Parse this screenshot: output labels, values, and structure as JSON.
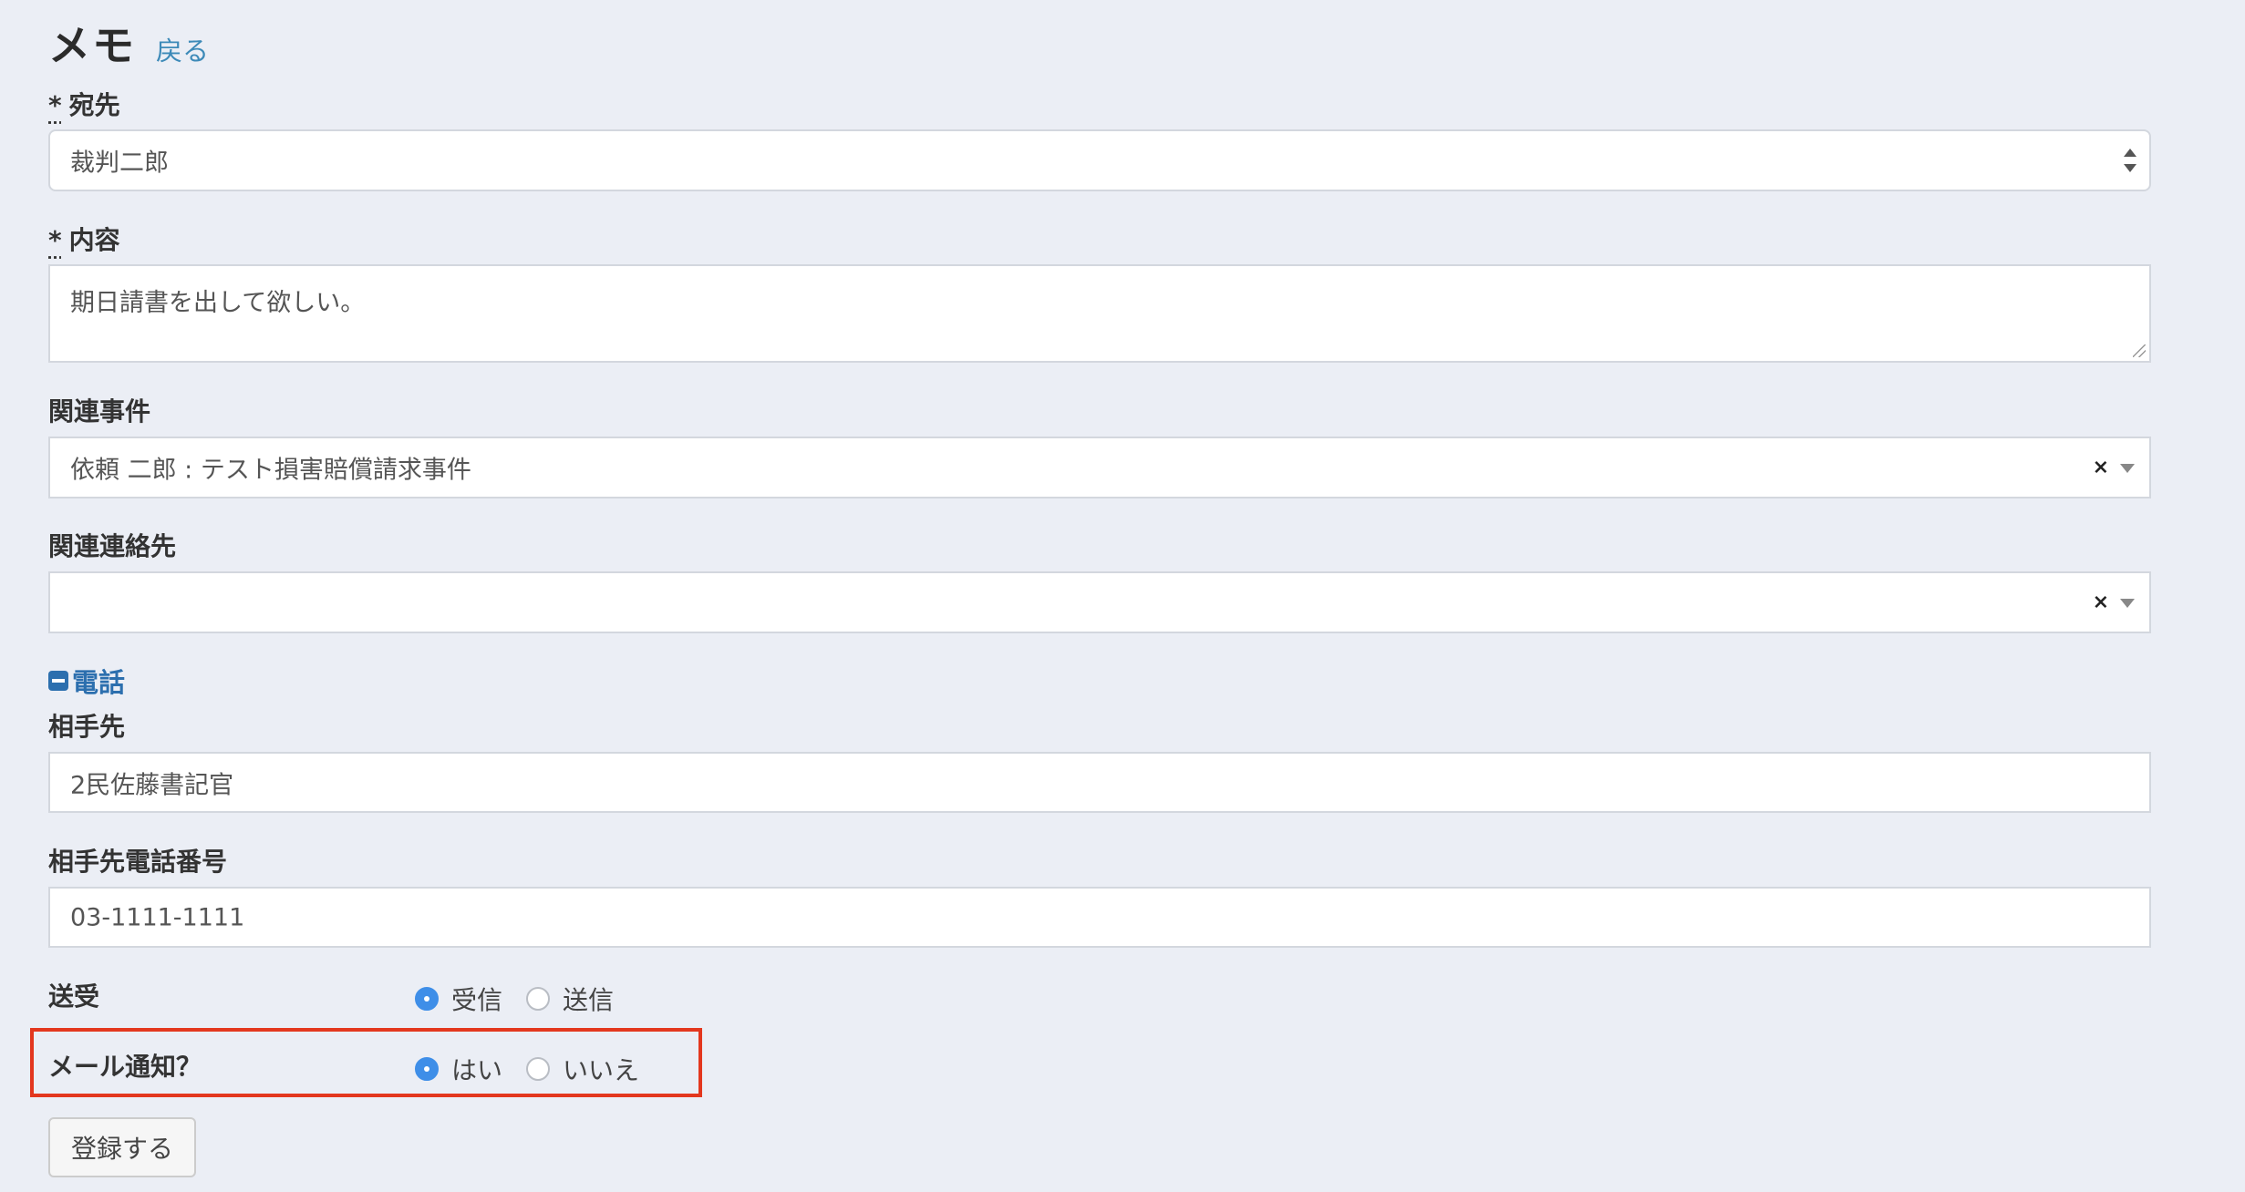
{
  "header": {
    "title": "メモ",
    "back_link": "戻る"
  },
  "form": {
    "required_mark": "*",
    "recipient": {
      "label": "宛先",
      "value": "裁判二郎"
    },
    "content": {
      "label": "内容",
      "value": "期日請書を出して欲しい。"
    },
    "related_case": {
      "label": "関連事件",
      "value": "依頼 二郎 : テスト損害賠償請求事件",
      "clear": "×"
    },
    "related_contact": {
      "label": "関連連絡先",
      "value": "",
      "clear": "×"
    },
    "phone_section": {
      "label": "電話"
    },
    "counterparty": {
      "label": "相手先",
      "value": "2民佐藤書記官"
    },
    "counterparty_phone": {
      "label": "相手先電話番号",
      "value": "03-1111-1111"
    },
    "direction": {
      "label": "送受",
      "options": [
        {
          "label": "受信",
          "checked": true
        },
        {
          "label": "送信",
          "checked": false
        }
      ]
    },
    "mail_notify": {
      "label": "メール通知？",
      "options": [
        {
          "label": "はい",
          "checked": true
        },
        {
          "label": "いいえ",
          "checked": false
        }
      ]
    },
    "submit_label": "登録する"
  },
  "colors": {
    "accent": "#3e8ee8",
    "link": "#3d8ab8",
    "highlight": "#e3371e",
    "background": "#ebeef5"
  }
}
